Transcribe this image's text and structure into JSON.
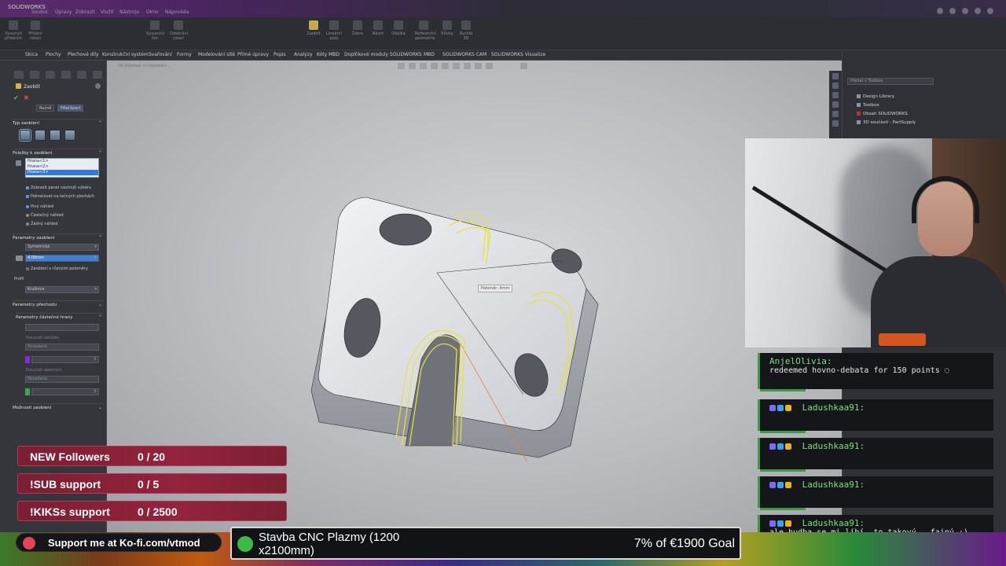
{
  "window": {
    "title": "SOLIDWORKS",
    "menu": [
      "Soubor",
      "Úpravy",
      "Zobrazit",
      "Vložit",
      "Nástroje",
      "Okno",
      "Nápověda"
    ]
  },
  "ribbon": {
    "buttons": [
      "Vysunutí přidáním",
      "Přidání rotací",
      "Vysunutý řez",
      "Odebrání rotací",
      "Zaoblit",
      "Lineární pole",
      "Žebro",
      "Návrh",
      "Obálka",
      "Referenční geometrie",
      "Křivky",
      "Rychlé 3D"
    ]
  },
  "tabs": [
    "Skica",
    "Plochy",
    "Plechové díly",
    "Konstrukční systém",
    "Svařování",
    "Formy",
    "Modelování sítě",
    "Přímé úpravy",
    "Popis",
    "Analýzy",
    "Kóty MBD",
    "Doplňkové moduly SOLIDWORKS",
    "MBD",
    "SOLIDWORKS CAM",
    "SOLIDWORKS Visualize"
  ],
  "property_manager": {
    "title": "Zaoblit",
    "mode_manual": "Ručně",
    "mode_filletxpert": "FilletXpert",
    "section_type": "Typ zaoblení",
    "section_items": "Položky k zaoblení",
    "edges": [
      "Hrana<1>",
      "Hrana<2>",
      "Hrana<3>"
    ],
    "opt_show_toolbar": "Zobrazit panel nástrojů výběru",
    "opt_tangent": "Pokračovat na tečných plochách",
    "preview_full": "Plný náhled",
    "preview_partial": "Částečný náhled",
    "preview_none": "Žádný náhled",
    "section_params": "Parametry zaoblení",
    "symmetry": "Symetrická",
    "radius": "4.00mm",
    "multi_radius": "Zaoblení s různými poloměry",
    "profile_label": "Profil",
    "profile": "Kružnice",
    "section_transition": "Parametry přechodu",
    "section_partial": "Parametry částečné hrany",
    "offset_start": "Posunutí začátku",
    "unspecified": "Nezadaná",
    "offset_end": "Posunutí ukončení",
    "section_options": "Možnosti zaoblení"
  },
  "viewport": {
    "breadcrumb": "Díl (Výchozí <<Výchozí>...",
    "dim_label": "Poloměr: 4mm"
  },
  "task_pane": {
    "search_placeholder": "Hledat v Toolbox",
    "items": [
      "Design Library",
      "Toolbox",
      "Obsah SOLIDWORKS",
      "3D součásti - PartSupply"
    ]
  },
  "chat": [
    {
      "user": "AnjelOlivia:",
      "text": "redeemed hovno-debata for 150 points ◌"
    },
    {
      "user": "Ladushkaa91:",
      "text": ""
    },
    {
      "user": "Ladushkaa91:",
      "text": ""
    },
    {
      "user": "Ladushkaa91:",
      "text": ""
    },
    {
      "user": "Ladushkaa91:",
      "text": "ale hudba se mi líbí, to takový.. fajný :)"
    }
  ],
  "goals": [
    {
      "label": "NEW Followers",
      "value": "0 / 20"
    },
    {
      "label": "!SUB support",
      "value": "0 / 5"
    },
    {
      "label": "!KIKSs support",
      "value": "0 / 2500"
    }
  ],
  "kofi": "Support me at Ko-fi.com/vtmod",
  "donation": {
    "title": "Stavba CNC Plazmy (1200 x2100mm)",
    "progress": "7% of €1900 Goal"
  },
  "colors": {
    "goal_bar": "#94233c",
    "chat_accent": "#3b9a43",
    "fillet_preview": "#e6e33a",
    "selected_edge": "#2f7ad9"
  }
}
